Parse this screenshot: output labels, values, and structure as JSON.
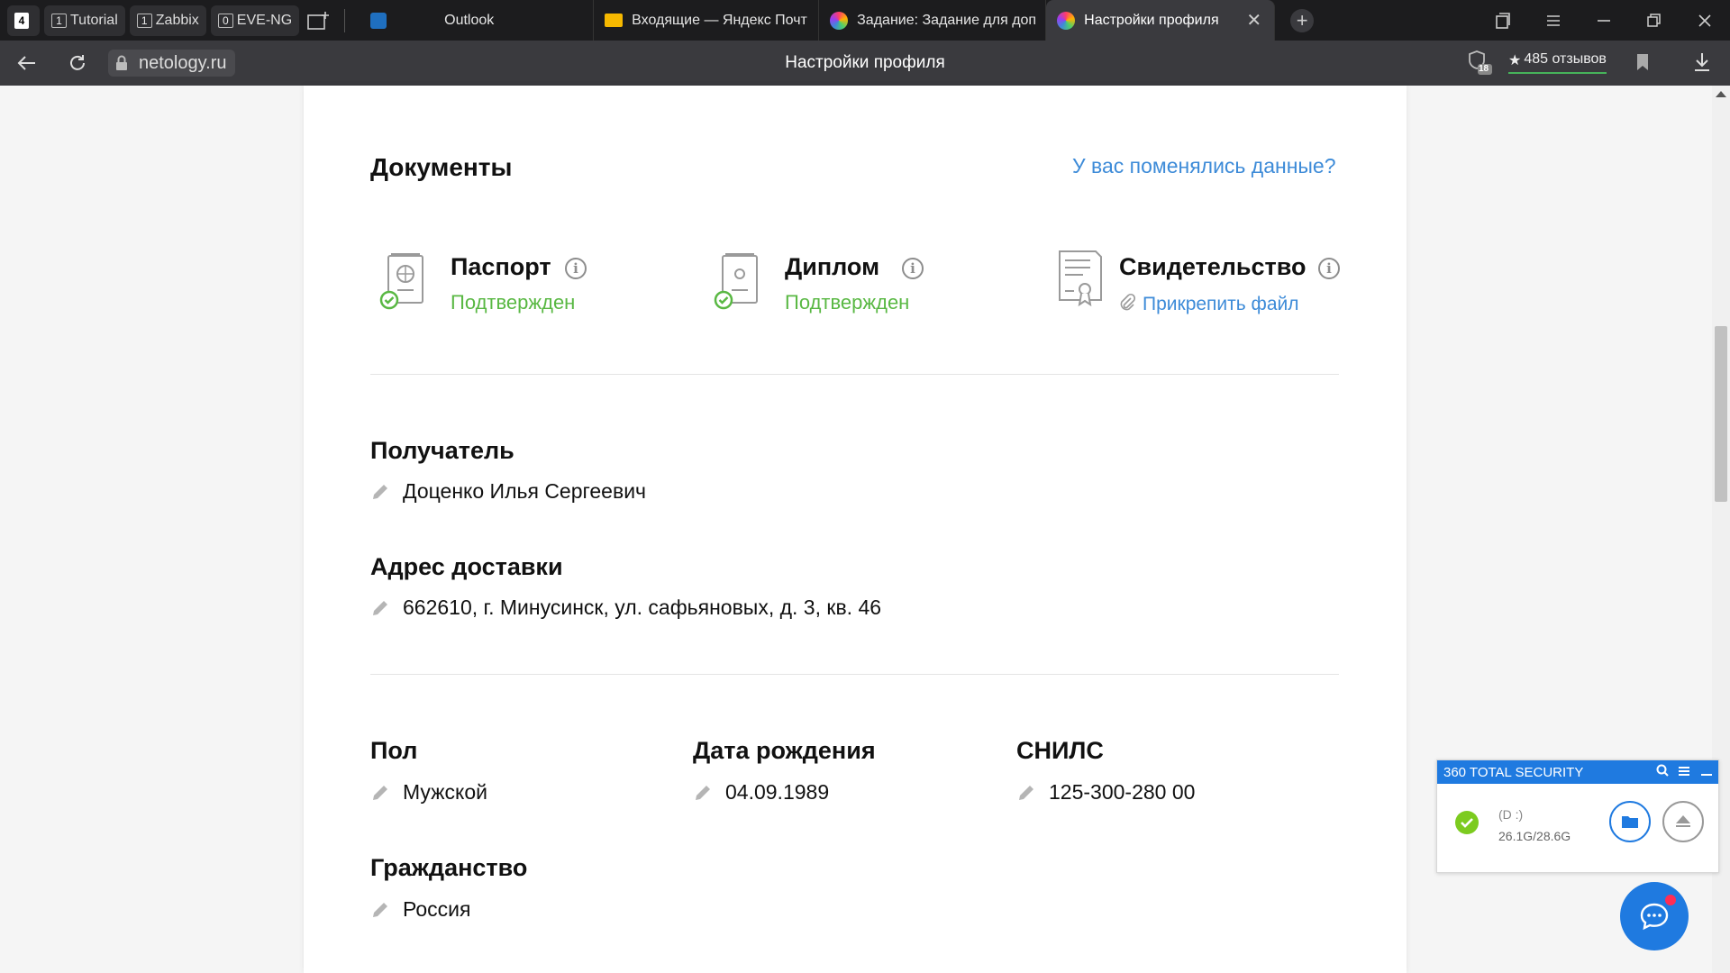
{
  "browser": {
    "tab_groups": [
      {
        "count": "4",
        "label": ""
      },
      {
        "count": "1",
        "label": "Tutorial"
      },
      {
        "count": "1",
        "label": "Zabbix"
      },
      {
        "count": "0",
        "label": "EVE-NG"
      }
    ],
    "tabs": [
      {
        "label": "Outlook",
        "icon": "outlook-icon",
        "color": "#1f6fbf"
      },
      {
        "label": "Входящие — Яндекс Почт",
        "icon": "yandex-mail-icon",
        "color": "#f6b800"
      },
      {
        "label": "Задание: Задание для доп",
        "icon": "netology-icon",
        "color": "#7a4df0"
      },
      {
        "label": "Настройки профиля",
        "icon": "netology-icon",
        "color": "#7a4df0"
      }
    ],
    "url": "netology.ru",
    "page_title": "Настройки профиля",
    "shield_badge": "18",
    "reviews": "485 отзывов"
  },
  "documents": {
    "title": "Документы",
    "changed_link": "У вас поменялись данные?",
    "items": [
      {
        "name": "Паспорт",
        "status": "Подтвержден"
      },
      {
        "name": "Диплом",
        "status": "Подтвержден"
      },
      {
        "name": "Свидетельство",
        "attach": "Прикрепить файл"
      }
    ]
  },
  "fields": {
    "recipient": {
      "label": "Получатель",
      "value": "Доценко Илья Сергеевич"
    },
    "address": {
      "label": "Адрес доставки",
      "value": "662610, г. Минусинск, ул. сафьяновых, д. 3, кв. 46"
    },
    "gender": {
      "label": "Пол",
      "value": "Мужской"
    },
    "birthdate": {
      "label": "Дата рождения",
      "value": "04.09.1989"
    },
    "snils": {
      "label": "СНИЛС",
      "value": "125-300-280 00"
    },
    "citizenship": {
      "label": "Гражданство",
      "value": "Россия"
    }
  },
  "widget360": {
    "title": "360 TOTAL SECURITY",
    "drive": "(D :)",
    "usage": "26.1G/28.6G"
  },
  "colors": {
    "accent_blue": "#3d8bd8",
    "confirmed_green": "#59b843",
    "widget_blue": "#1f7ae0"
  }
}
